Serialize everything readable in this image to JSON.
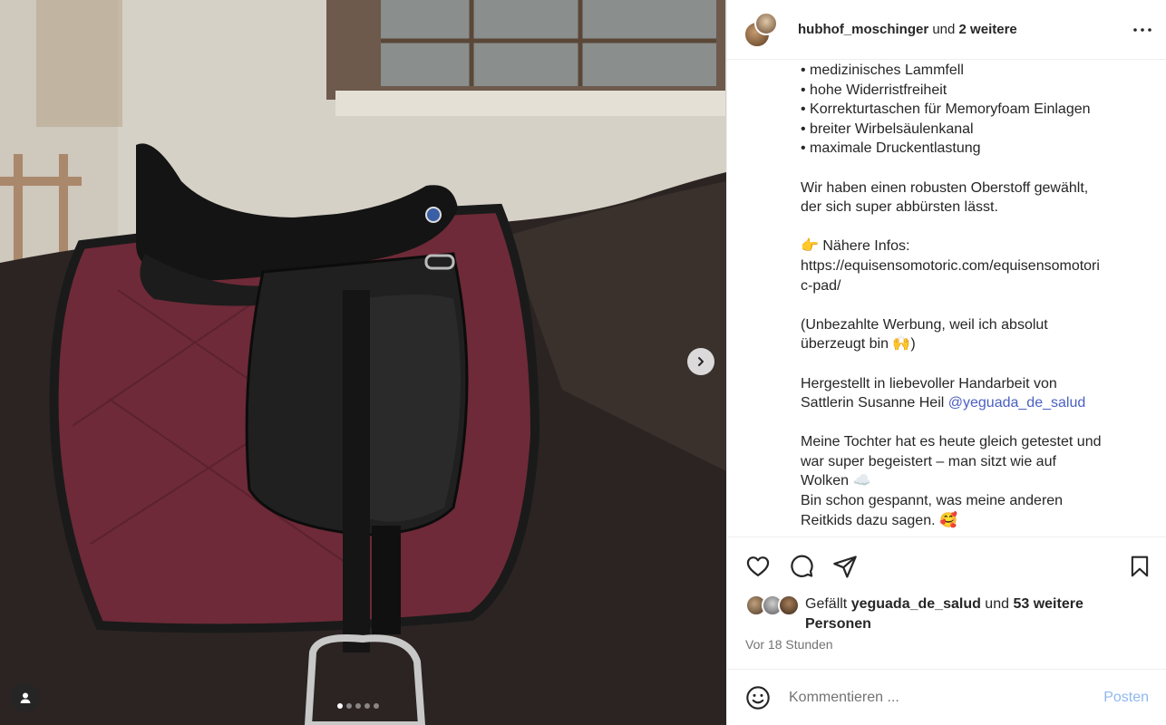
{
  "header": {
    "username": "hubhof_moschinger",
    "connector": " und ",
    "others": "2 weitere"
  },
  "caption_lines": [
    "• medizinisches Lammfell",
    "• hohe Widerristfreiheit",
    "• Korrekturtaschen für Memoryfoam Einlagen",
    "• breiter Wirbelsäulenkanal",
    "• maximale Druckentlastung",
    "",
    "Wir haben einen robusten Oberstoff gewählt,",
    "der sich super abbürsten lässt.",
    "",
    "👉 Nähere Infos:",
    "https://equisensomotoric.com/equisensomotori",
    "c-pad/",
    "",
    "(Unbezahlte Werbung, weil ich absolut",
    "überzeugt bin 🙌)",
    "",
    "Hergestellt in liebevoller Handarbeit von"
  ],
  "caption_mention_line": {
    "text": "Sattlerin Susanne Heil ",
    "mention": "@yeguada_de_salud"
  },
  "caption_tail_lines": [
    "",
    "Meine Tochter hat es heute gleich getestet und",
    "war super begeistert – man sitzt wie auf",
    "Wolken ☁️",
    "Bin schon gespannt, was meine anderen",
    "Reitkids dazu sagen. 🥰"
  ],
  "likes": {
    "prefix": "Gefällt ",
    "user": "yeguada_de_salud",
    "connector": " und ",
    "others": "53 weitere Personen"
  },
  "timestamp": "Vor 18 Stunden",
  "comment": {
    "placeholder": "Kommentieren ...",
    "post_label": "Posten"
  },
  "carousel": {
    "slide_count": 5,
    "active_index": 0
  }
}
